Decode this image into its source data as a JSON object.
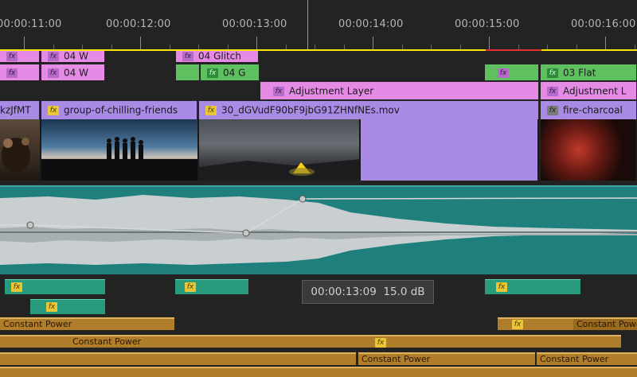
{
  "ruler": {
    "timecodes": [
      "00:00:11:00",
      "00:00:12:00",
      "00:00:13:00",
      "00:00:14:00",
      "00:00:15:00",
      "00:00:16:00"
    ]
  },
  "video_tracks": {
    "top_row": [
      {
        "label": "04 W",
        "fx": "pink"
      },
      {
        "label": "04 W",
        "fx": "pink"
      },
      {
        "label": "04 Glitch",
        "fx": "pink"
      }
    ],
    "row2": [
      {
        "label": "04 W",
        "fx": "pink"
      },
      {
        "label": "04 W",
        "fx": "pink"
      },
      {
        "label": "04 G",
        "fx": "green"
      },
      {
        "label": "03 Flat",
        "fx": "green"
      }
    ],
    "adjustment": [
      {
        "label": "Adjustment Layer"
      },
      {
        "label": "Adjustment L"
      }
    ],
    "media": [
      {
        "label": "kzJfMT"
      },
      {
        "label": "group-of-chilling-friends"
      },
      {
        "label": "30_dGVudF90bF9jbG91ZHNfNEs.mov"
      },
      {
        "label": "fire-charcoal"
      }
    ]
  },
  "fx_badge": "fx",
  "tooltip": {
    "time": "00:00:13:09",
    "gain": "15.0 dB"
  },
  "transitions": {
    "row1": [
      "Constant Power",
      "Constant Power"
    ],
    "row2": [
      "Constant Power"
    ],
    "row3": [
      "Constant Power",
      "Constant Power"
    ]
  },
  "colors": {
    "clip_pink": "#e58be6",
    "clip_green": "#5fc060",
    "clip_lavender": "#a98be6",
    "audio_teal": "#1f7f7c",
    "audio_clip": "#2a9a7c",
    "transition": "#b07d2a",
    "work_area_yellow": "#ffe600",
    "work_area_red": "#e53030"
  }
}
